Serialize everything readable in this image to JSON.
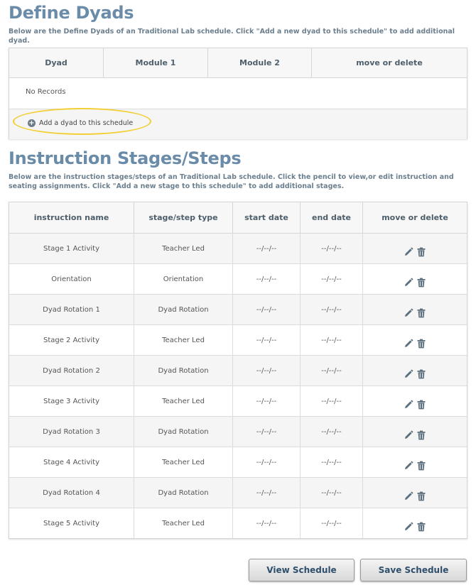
{
  "dyads": {
    "title": "Define Dyads",
    "description": "Below are the Define Dyads of an Traditional Lab schedule. Click \"Add a new dyad to this schedule\" to add additional dyad.",
    "columns": [
      "Dyad",
      "Module 1",
      "Module 2",
      "move or delete"
    ],
    "empty_text": "No Records",
    "add_label": "Add a dyad to this schedule"
  },
  "stages": {
    "title": "Instruction Stages/Steps",
    "description": "Below are the instruction stages/steps of an Traditional Lab schedule. Click the pencil to view,or edit instruction and seating assignments. Click \"Add a new stage to this schedule\" to add additional stages.",
    "columns": [
      "instruction name",
      "stage/step type",
      "start date",
      "end date",
      "move or delete"
    ],
    "rows": [
      {
        "name": "Stage 1 Activity",
        "type": "Teacher Led",
        "start": "--/--/--",
        "end": "--/--/--"
      },
      {
        "name": "Orientation",
        "type": "Orientation",
        "start": "--/--/--",
        "end": "--/--/--"
      },
      {
        "name": "Dyad Rotation 1",
        "type": "Dyad Rotation",
        "start": "--/--/--",
        "end": "--/--/--"
      },
      {
        "name": "Stage 2 Activity",
        "type": "Teacher Led",
        "start": "--/--/--",
        "end": "--/--/--"
      },
      {
        "name": "Dyad Rotation 2",
        "type": "Dyad Rotation",
        "start": "--/--/--",
        "end": "--/--/--"
      },
      {
        "name": "Stage 3 Activity",
        "type": "Teacher Led",
        "start": "--/--/--",
        "end": "--/--/--"
      },
      {
        "name": "Dyad Rotation 3",
        "type": "Dyad Rotation",
        "start": "--/--/--",
        "end": "--/--/--"
      },
      {
        "name": "Stage 4 Activity",
        "type": "Teacher Led",
        "start": "--/--/--",
        "end": "--/--/--"
      },
      {
        "name": "Dyad Rotation 4",
        "type": "Dyad Rotation",
        "start": "--/--/--",
        "end": "--/--/--"
      },
      {
        "name": "Stage 5 Activity",
        "type": "Teacher Led",
        "start": "--/--/--",
        "end": "--/--/--"
      }
    ]
  },
  "actions": {
    "view_label": "View Schedule",
    "save_label": "Save Schedule"
  },
  "icons": {
    "edit": "pencil-icon",
    "delete": "trash-icon",
    "add": "plus-circle-icon"
  },
  "colors": {
    "heading": "#6a8ca8",
    "button_text": "#2e4e6b",
    "highlight": "#f2cf35"
  }
}
